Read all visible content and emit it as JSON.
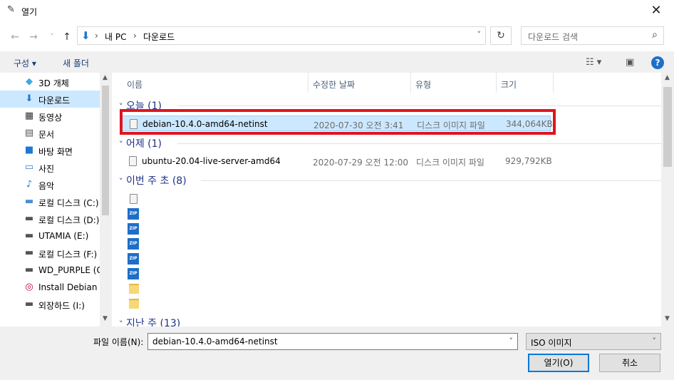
{
  "window": {
    "title": "열기",
    "close": "✕"
  },
  "nav": {
    "back": "←",
    "forward": "→",
    "up": "↑",
    "breadcrumb": [
      "내 PC",
      "다운로드"
    ],
    "sep": "›",
    "refresh": "↻",
    "search_placeholder": "다운로드 검색"
  },
  "toolbar": {
    "organize": "구성 ▾",
    "new_folder": "새 폴더"
  },
  "sidebar": {
    "items": [
      {
        "label": "3D 개체",
        "icon": "cube-icon",
        "glyph": "◆",
        "color": "#3fa9e0"
      },
      {
        "label": "다운로드",
        "icon": "download-icon",
        "glyph": "⬇",
        "color": "#1e78d6"
      },
      {
        "label": "동영상",
        "icon": "film-icon",
        "glyph": "▦",
        "color": "#333333"
      },
      {
        "label": "문서",
        "icon": "document-icon",
        "glyph": "▤",
        "color": "#555555"
      },
      {
        "label": "바탕 화면",
        "icon": "desktop-icon",
        "glyph": "■",
        "color": "#1e78d6"
      },
      {
        "label": "사진",
        "icon": "picture-icon",
        "glyph": "▭",
        "color": "#3b7dc4"
      },
      {
        "label": "음악",
        "icon": "music-icon",
        "glyph": "♪",
        "color": "#1e78d6"
      },
      {
        "label": "로컬 디스크 (C:)",
        "icon": "system-drive-icon",
        "glyph": "▬",
        "color": "#4a8fd6"
      },
      {
        "label": "로컬 디스크 (D:)",
        "icon": "drive-icon",
        "glyph": "▬",
        "color": "#555555"
      },
      {
        "label": "UTAMIA (E:)",
        "icon": "drive-icon",
        "glyph": "▬",
        "color": "#555555"
      },
      {
        "label": "로컬 디스크 (F:)",
        "icon": "drive-icon",
        "glyph": "▬",
        "color": "#555555"
      },
      {
        "label": "WD_PURPLE (G:)",
        "icon": "drive-icon",
        "glyph": "▬",
        "color": "#555555"
      },
      {
        "label": "Install Debian G",
        "icon": "debian-icon",
        "glyph": "◎",
        "color": "#c70036"
      },
      {
        "label": "외장하드 (I:)",
        "icon": "drive-icon",
        "glyph": "▬",
        "color": "#555555"
      }
    ],
    "selected_index": 1
  },
  "columns": {
    "name": "이름",
    "date": "수정한 날짜",
    "type": "유형",
    "size": "크기"
  },
  "groups": [
    {
      "label": "오늘 (1)"
    },
    {
      "label": "어제 (1)"
    },
    {
      "label": "이번 주 초 (8)"
    },
    {
      "label": "지난 주 (13)"
    }
  ],
  "files": [
    {
      "name": "debian-10.4.0-amd64-netinst",
      "date": "2020-07-30 오전 3:41",
      "type": "디스크 이미지 파일",
      "size": "344,064KB"
    },
    {
      "name": "ubuntu-20.04-live-server-amd64",
      "date": "2020-07-29 오전 12:00",
      "type": "디스크 이미지 파일",
      "size": "929,792KB"
    }
  ],
  "bottom": {
    "filename_label": "파일 이름(N):",
    "filename_value": "debian-10.4.0-amd64-netinst",
    "filetype_value": "ISO 이미지",
    "open_label": "열기(O)",
    "cancel_label": "취소"
  },
  "colors": {
    "accent": "#0078d7",
    "highlight": "#cce8ff",
    "annotation_red": "#e0141e",
    "group_text": "#1e3287"
  }
}
